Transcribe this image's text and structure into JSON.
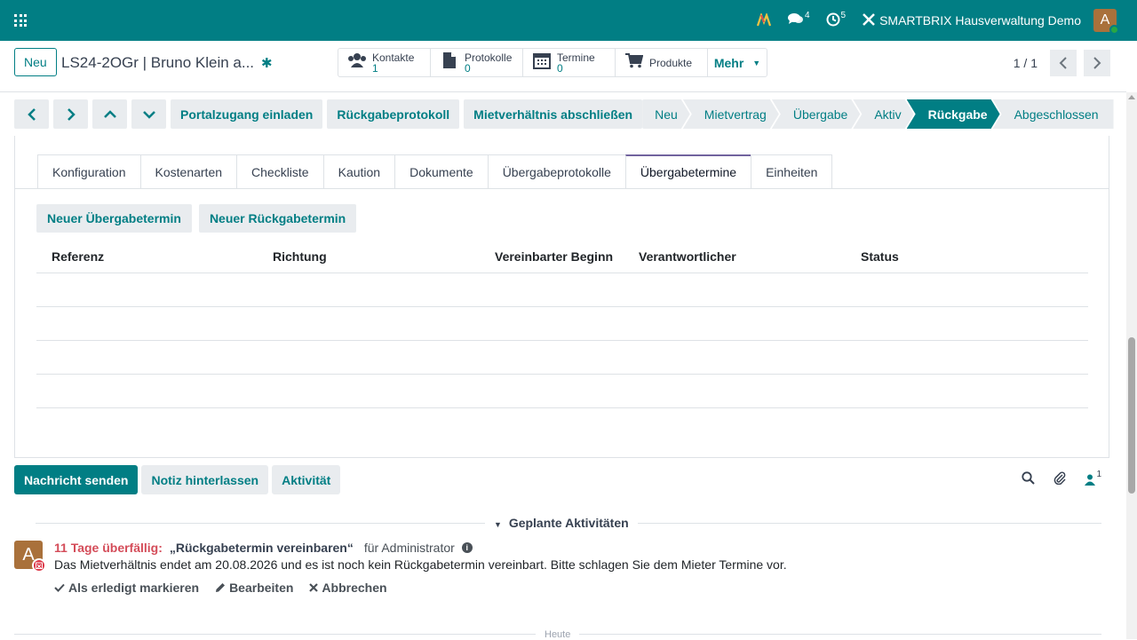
{
  "navbar": {
    "messages_count": "4",
    "activities_count": "5",
    "company": "SMARTBRIX Hausverwaltung Demo",
    "user_initial": "A",
    "accent": "#017e84"
  },
  "control": {
    "new_label": "Neu",
    "record_title": "LS24-2OGr | Bruno Klein a...",
    "smart_buttons": [
      {
        "label": "Kontakte",
        "value": "1",
        "icon": "users-icon"
      },
      {
        "label": "Protokolle",
        "value": "0",
        "icon": "file-icon"
      },
      {
        "label": "Termine",
        "value": "0",
        "icon": "calendar-icon"
      },
      {
        "label": "Produkte",
        "icon": "cart-icon"
      }
    ],
    "more_label": "Mehr",
    "pager": "1 / 1"
  },
  "statusbar": {
    "actions": [
      "Portalzugang einladen",
      "Rückgabeprotokoll",
      "Mietverhältnis abschließen"
    ],
    "stages": [
      "Neu",
      "Mietvertrag",
      "Übergabe",
      "Aktiv",
      "Rückgabe",
      "Abgeschlossen"
    ],
    "active_stage": "Rückgabe"
  },
  "tabs": [
    "Konfiguration",
    "Kostenarten",
    "Checkliste",
    "Kaution",
    "Dokumente",
    "Übergabeprotokolle",
    "Übergabetermine",
    "Einheiten"
  ],
  "active_tab": "Übergabetermine",
  "list": {
    "buttons": [
      "Neuer Übergabetermin",
      "Neuer Rückgabetermin"
    ],
    "columns": [
      "Referenz",
      "Richtung",
      "Vereinbarter Beginn",
      "Verantwortlicher",
      "Status"
    ]
  },
  "chatter": {
    "send_message": "Nachricht senden",
    "log_note": "Notiz hinterlassen",
    "activity": "Aktivität",
    "followers_count": "1",
    "planned_title": "Geplante Aktivitäten",
    "activity_item": {
      "avatar_initial": "A",
      "overdue": "11 Tage überfällig:",
      "summary": "„Rückgabetermin vereinbaren“",
      "assigned": "für Administrator",
      "note": "Das Mietverhältnis endet am 20.08.2026 und es ist noch kein Rückgabetermin vereinbart. Bitte schlagen Sie dem Mieter Termine vor.",
      "mark_done": "Als erledigt markieren",
      "edit": "Bearbeiten",
      "cancel": "Abbrechen"
    },
    "today_label": "Heute"
  }
}
